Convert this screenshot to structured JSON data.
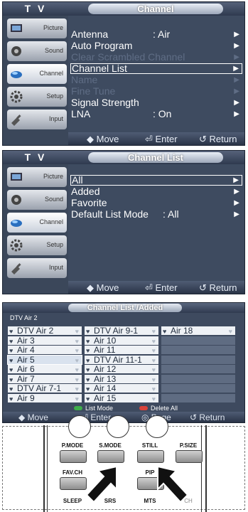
{
  "menu1": {
    "tv": "T V",
    "title": "Channel",
    "sidebar": [
      "Picture",
      "Sound",
      "Channel",
      "Setup",
      "Input"
    ],
    "rows": [
      {
        "label": "Antenna",
        "value": ": Air",
        "arrow": "▶",
        "state": "normal"
      },
      {
        "label": "Auto Program",
        "value": "",
        "arrow": "▶",
        "state": "normal"
      },
      {
        "label": "Clear Scrambled Channel",
        "value": "",
        "arrow": "▶",
        "state": "dim"
      },
      {
        "label": "Channel List",
        "value": "",
        "arrow": "▶",
        "state": "selected"
      },
      {
        "label": "Name",
        "value": "",
        "arrow": "▶",
        "state": "dim"
      },
      {
        "label": "Fine Tune",
        "value": "",
        "arrow": "▶",
        "state": "dim"
      },
      {
        "label": "Signal Strength",
        "value": "",
        "arrow": "▶",
        "state": "normal"
      },
      {
        "label": "LNA",
        "value": ": On",
        "arrow": "▶",
        "state": "normal"
      }
    ],
    "footer": {
      "move": "◆ Move",
      "enter": "⏎ Enter",
      "return": "↺ Return"
    }
  },
  "menu2": {
    "tv": "T V",
    "title": "Channel List",
    "sidebar": [
      "Picture",
      "Sound",
      "Channel",
      "Setup",
      "Input"
    ],
    "rows": [
      {
        "label": "All",
        "value": "",
        "arrow": "▶",
        "state": "selected"
      },
      {
        "label": "Added",
        "value": "",
        "arrow": "▶",
        "state": "normal"
      },
      {
        "label": "Favorite",
        "value": "",
        "arrow": "▶",
        "state": "normal"
      },
      {
        "label": "Default List Mode",
        "value": ": All",
        "arrow": "▶",
        "state": "normal"
      }
    ],
    "footer": {
      "move": "◆ Move",
      "enter": "⏎ Enter",
      "return": "↺ Return"
    }
  },
  "channel_list": {
    "title": "Channel List /Added",
    "subtitle": "DTV Air 2",
    "columns": [
      [
        "DTV Air 2",
        "Air 3",
        "Air 4",
        "Air 5",
        "Air 6",
        "Air 7",
        "DTV Air 7-1",
        "Air 9"
      ],
      [
        "DTV Air 9-1",
        "Air 10",
        "Air 11",
        "DTV Air 11-1",
        "Air 12",
        "Air 13",
        "Air 14",
        "Air 15"
      ],
      [
        "Air 18",
        "",
        "",
        "",
        "",
        "",
        "",
        ""
      ]
    ],
    "selected": "Air 5",
    "legend": {
      "list_mode": "List Mode",
      "delete_all": "Delete All"
    },
    "footer": {
      "move": "◆ Move",
      "enter": "⏎ Enter",
      "page": "◎ Page",
      "return": "↺ Return"
    }
  },
  "remote": {
    "buttons": [
      "P.MODE",
      "S.MODE",
      "STILL",
      "P.SIZE",
      "FAV.CH",
      "PIP",
      "SLEEP",
      "SRS",
      "MTS",
      "CH"
    ]
  },
  "colors": {
    "panel": "#3e4b60",
    "highlight_text": "#ffffff",
    "dim_text": "#5f6d85",
    "legend_green": "#3fae4b",
    "legend_red": "#d9433a"
  }
}
